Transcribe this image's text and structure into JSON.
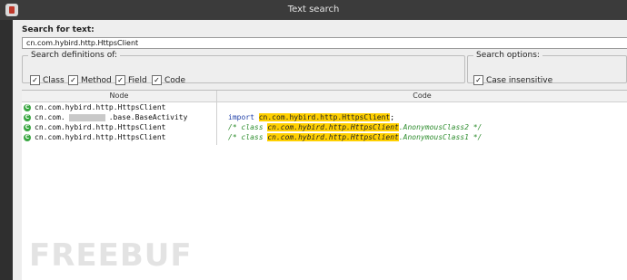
{
  "window": {
    "title": "Text search"
  },
  "search": {
    "label": "Search for text:",
    "value": "cn.com.hybird.http.HttpsClient"
  },
  "definitions": {
    "legend": "Search definitions of:",
    "options": [
      {
        "label": "Class",
        "checked": true
      },
      {
        "label": "Method",
        "checked": true
      },
      {
        "label": "Field",
        "checked": true
      },
      {
        "label": "Code",
        "checked": true
      }
    ]
  },
  "search_options": {
    "legend": "Search options:",
    "case_insensitive": {
      "label": "Case insensitive",
      "checked": true
    }
  },
  "results": {
    "columns": {
      "node": "Node",
      "code": "Code"
    },
    "rows": [
      {
        "node": "cn.com.hybird.http.HttpsClient",
        "code_kw": "import",
        "code_hl": "cn.com.hybird.http.HttpsClient",
        "code_suffix": ";"
      },
      {
        "node_prefix": "cn.com.",
        "node_suffix": ".base.BaseActivity",
        "code_kw": "/* class",
        "code_hl": "cn.com.hybird.http.HttpsClient",
        "code_suffix": ".AnonymousClass2 */"
      },
      {
        "node": "cn.com.hybird.http.HttpsClient",
        "code_kw": "/* class",
        "code_hl": "cn.com.hybird.http.HttpsClient",
        "code_suffix": ".AnonymousClass1 */"
      },
      {
        "node": "cn.com.hybird.http.HttpsClient"
      }
    ]
  },
  "watermark": "FREEBUF",
  "icons": {
    "app": "app-icon",
    "class": "class-icon",
    "check": "checkmark-icon"
  }
}
